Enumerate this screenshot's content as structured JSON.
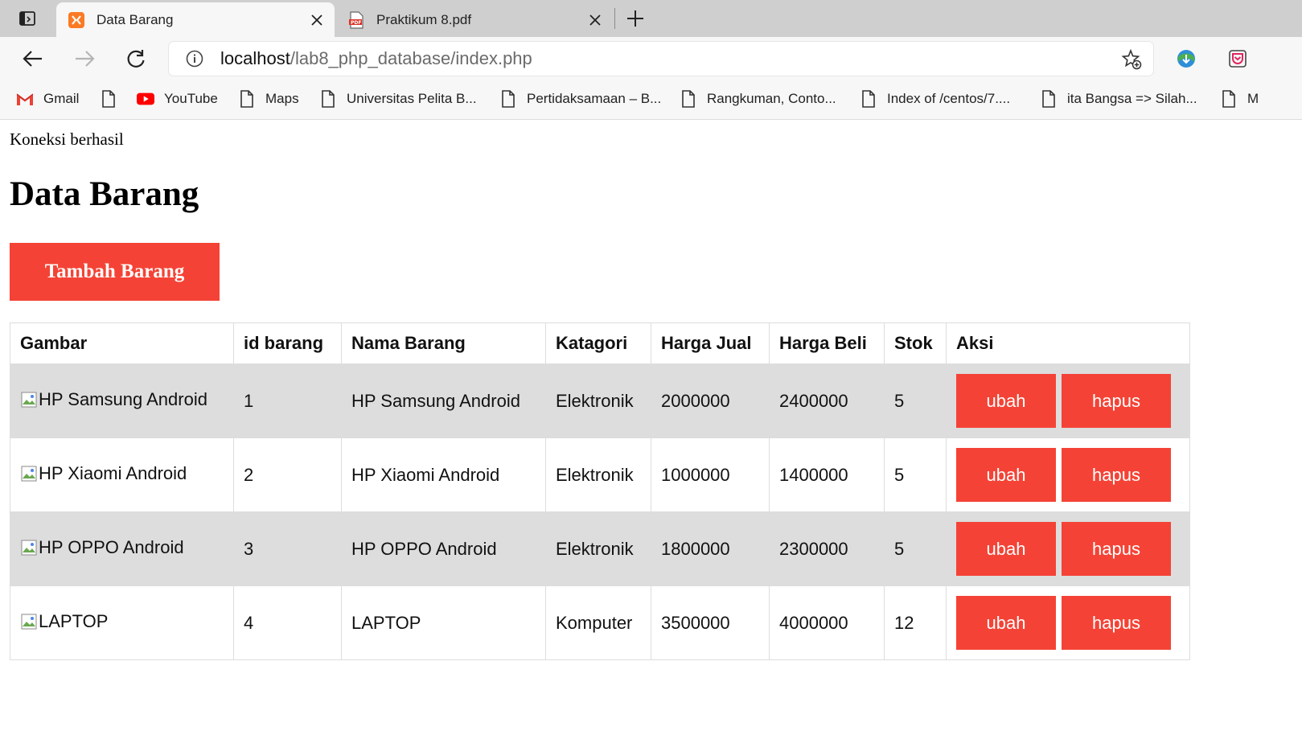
{
  "browser": {
    "tabs": [
      {
        "title": "Data Barang",
        "active": true,
        "icon": "xampp-icon"
      },
      {
        "title": "Praktikum 8.pdf",
        "active": false,
        "icon": "pdf-icon"
      }
    ],
    "url_host": "localhost",
    "url_path": "/lab8_php_database/index.php",
    "bookmarks": [
      {
        "label": "Gmail",
        "icon": "gmail-icon"
      },
      {
        "label": "YouTube",
        "icon": "youtube-icon"
      },
      {
        "label": "Maps",
        "icon": "page-icon"
      },
      {
        "label": "Universitas Pelita B...",
        "icon": "page-icon"
      },
      {
        "label": "Pertidaksamaan – B...",
        "icon": "page-icon"
      },
      {
        "label": "Rangkuman, Conto...",
        "icon": "page-icon"
      },
      {
        "label": "Index of /centos/7....",
        "icon": "page-icon"
      },
      {
        "label": "ita Bangsa => Silah...",
        "icon": "page-icon"
      },
      {
        "label": "M",
        "icon": "page-icon"
      }
    ]
  },
  "page": {
    "status": "Koneksi berhasil",
    "title": "Data Barang",
    "add_button": "Tambah Barang",
    "accent_color": "#f44336",
    "table": {
      "headers": [
        "Gambar",
        "id barang",
        "Nama Barang",
        "Katagori",
        "Harga Jual",
        "Harga Beli",
        "Stok",
        "Aksi"
      ],
      "rows": [
        {
          "image_alt": "HP Samsung Android",
          "id": "1",
          "name": "HP Samsung Android",
          "category": "Elektronik",
          "sell": "2000000",
          "buy": "2400000",
          "stock": "5"
        },
        {
          "image_alt": "HP Xiaomi Android",
          "id": "2",
          "name": "HP Xiaomi Android",
          "category": "Elektronik",
          "sell": "1000000",
          "buy": "1400000",
          "stock": "5"
        },
        {
          "image_alt": "HP OPPO Android",
          "id": "3",
          "name": "HP OPPO Android",
          "category": "Elektronik",
          "sell": "1800000",
          "buy": "2300000",
          "stock": "5"
        },
        {
          "image_alt": "LAPTOP",
          "id": "4",
          "name": "LAPTOP",
          "category": "Komputer",
          "sell": "3500000",
          "buy": "4000000",
          "stock": "12"
        }
      ],
      "edit_label": "ubah",
      "delete_label": "hapus"
    }
  }
}
